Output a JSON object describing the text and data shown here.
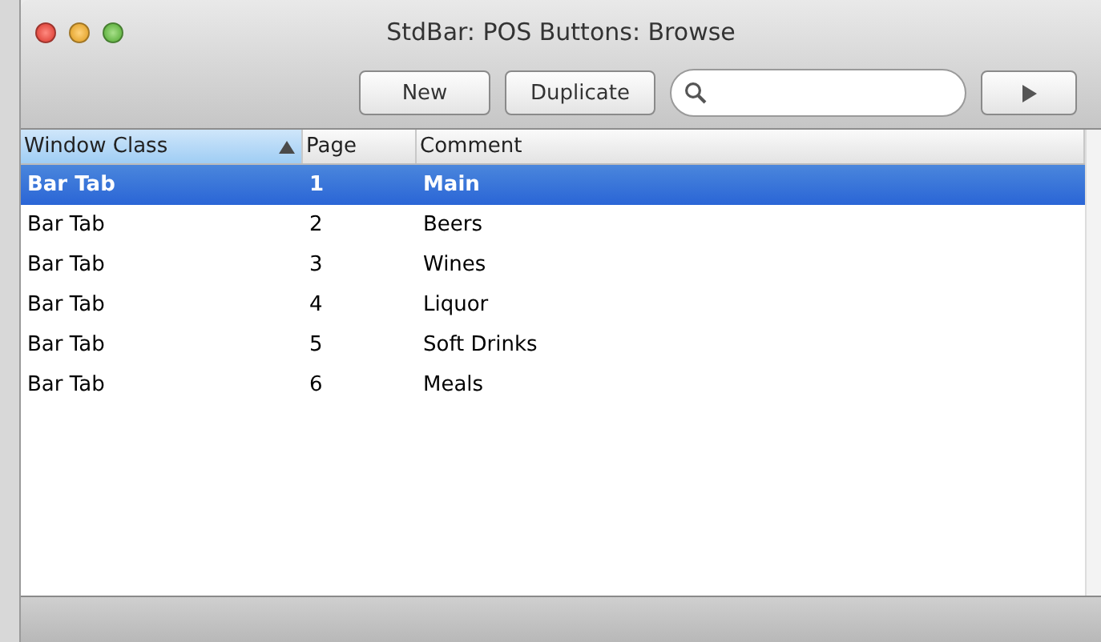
{
  "window": {
    "title": "StdBar: POS Buttons: Browse"
  },
  "toolbar": {
    "buttons": [
      "New",
      "Duplicate"
    ]
  },
  "table": {
    "columns": [
      {
        "label": "Window Class",
        "sorted": true
      },
      {
        "label": "Page",
        "sorted": false
      },
      {
        "label": "Comment",
        "sorted": false
      }
    ],
    "rows": [
      {
        "cells": [
          "Bar Tab",
          "1",
          "Main"
        ],
        "selected": true
      },
      {
        "cells": [
          "Bar Tab",
          "2",
          "Beers"
        ],
        "selected": false
      },
      {
        "cells": [
          "Bar Tab",
          "3",
          "Wines"
        ],
        "selected": false
      },
      {
        "cells": [
          "Bar Tab",
          "4",
          "Liquor"
        ],
        "selected": false
      },
      {
        "cells": [
          "Bar Tab",
          "5",
          "Soft Drinks"
        ],
        "selected": false
      },
      {
        "cells": [
          "Bar Tab",
          "6",
          "Meals"
        ],
        "selected": false
      }
    ]
  }
}
